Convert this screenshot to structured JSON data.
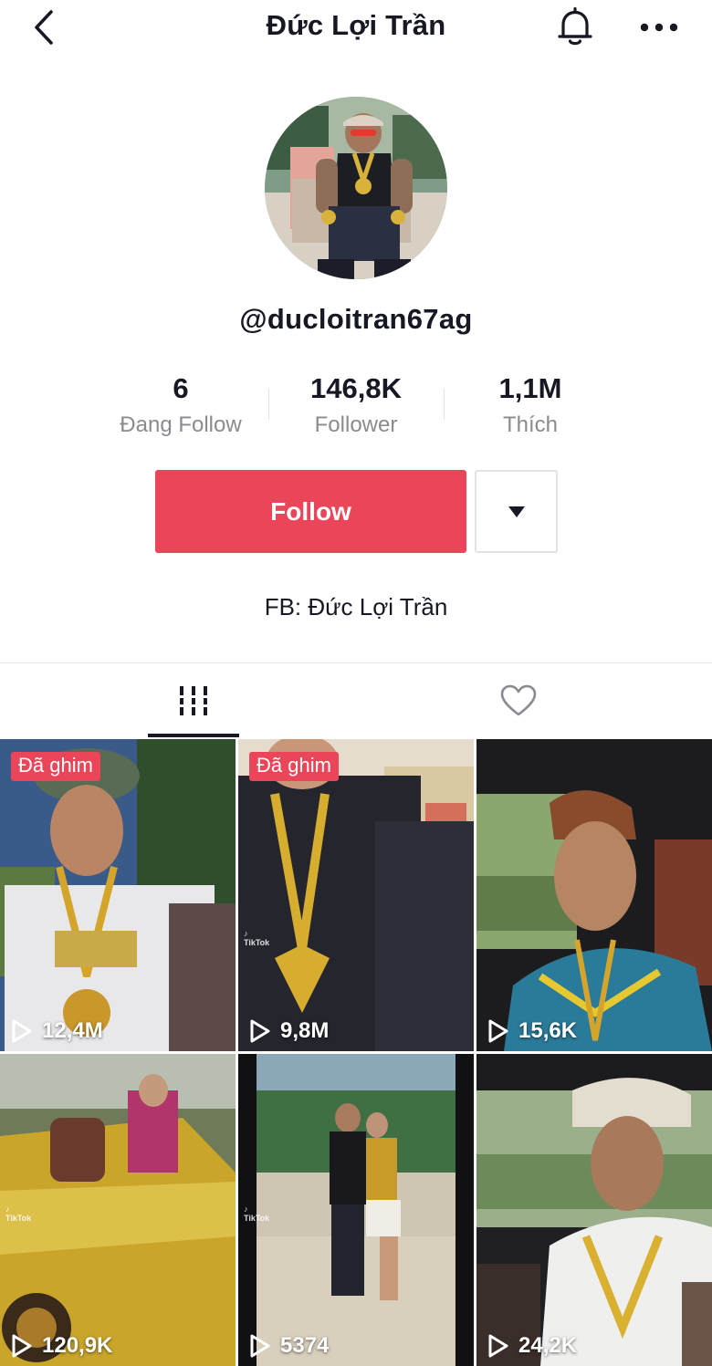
{
  "header": {
    "title": "Đức Lợi Trần",
    "back_icon": "chevron-left-icon",
    "bell_icon": "bell-icon",
    "more_icon": "more-dots-icon"
  },
  "profile": {
    "username": "@ducloitran67ag",
    "bio": "FB: Đức Lợi Trần"
  },
  "stats": [
    {
      "value": "6",
      "label": "Đang Follow"
    },
    {
      "value": "146,8K",
      "label": "Follower"
    },
    {
      "value": "1,1M",
      "label": "Thích"
    }
  ],
  "actions": {
    "follow_label": "Follow",
    "dropdown_icon": "caret-down-icon"
  },
  "tabs": [
    {
      "icon": "videos-grid-icon",
      "active": true
    },
    {
      "icon": "heart-outline-icon",
      "active": false
    }
  ],
  "videos": [
    {
      "pinned_label": "Đã ghim",
      "views": "12,4M"
    },
    {
      "pinned_label": "Đã ghim",
      "views": "9,8M"
    },
    {
      "views": "15,6K"
    },
    {
      "views": "120,9K"
    },
    {
      "views": "5374"
    },
    {
      "views": "24,2K"
    }
  ],
  "colors": {
    "accent": "#ea4558",
    "text": "#161823",
    "muted": "#8a8b91"
  }
}
